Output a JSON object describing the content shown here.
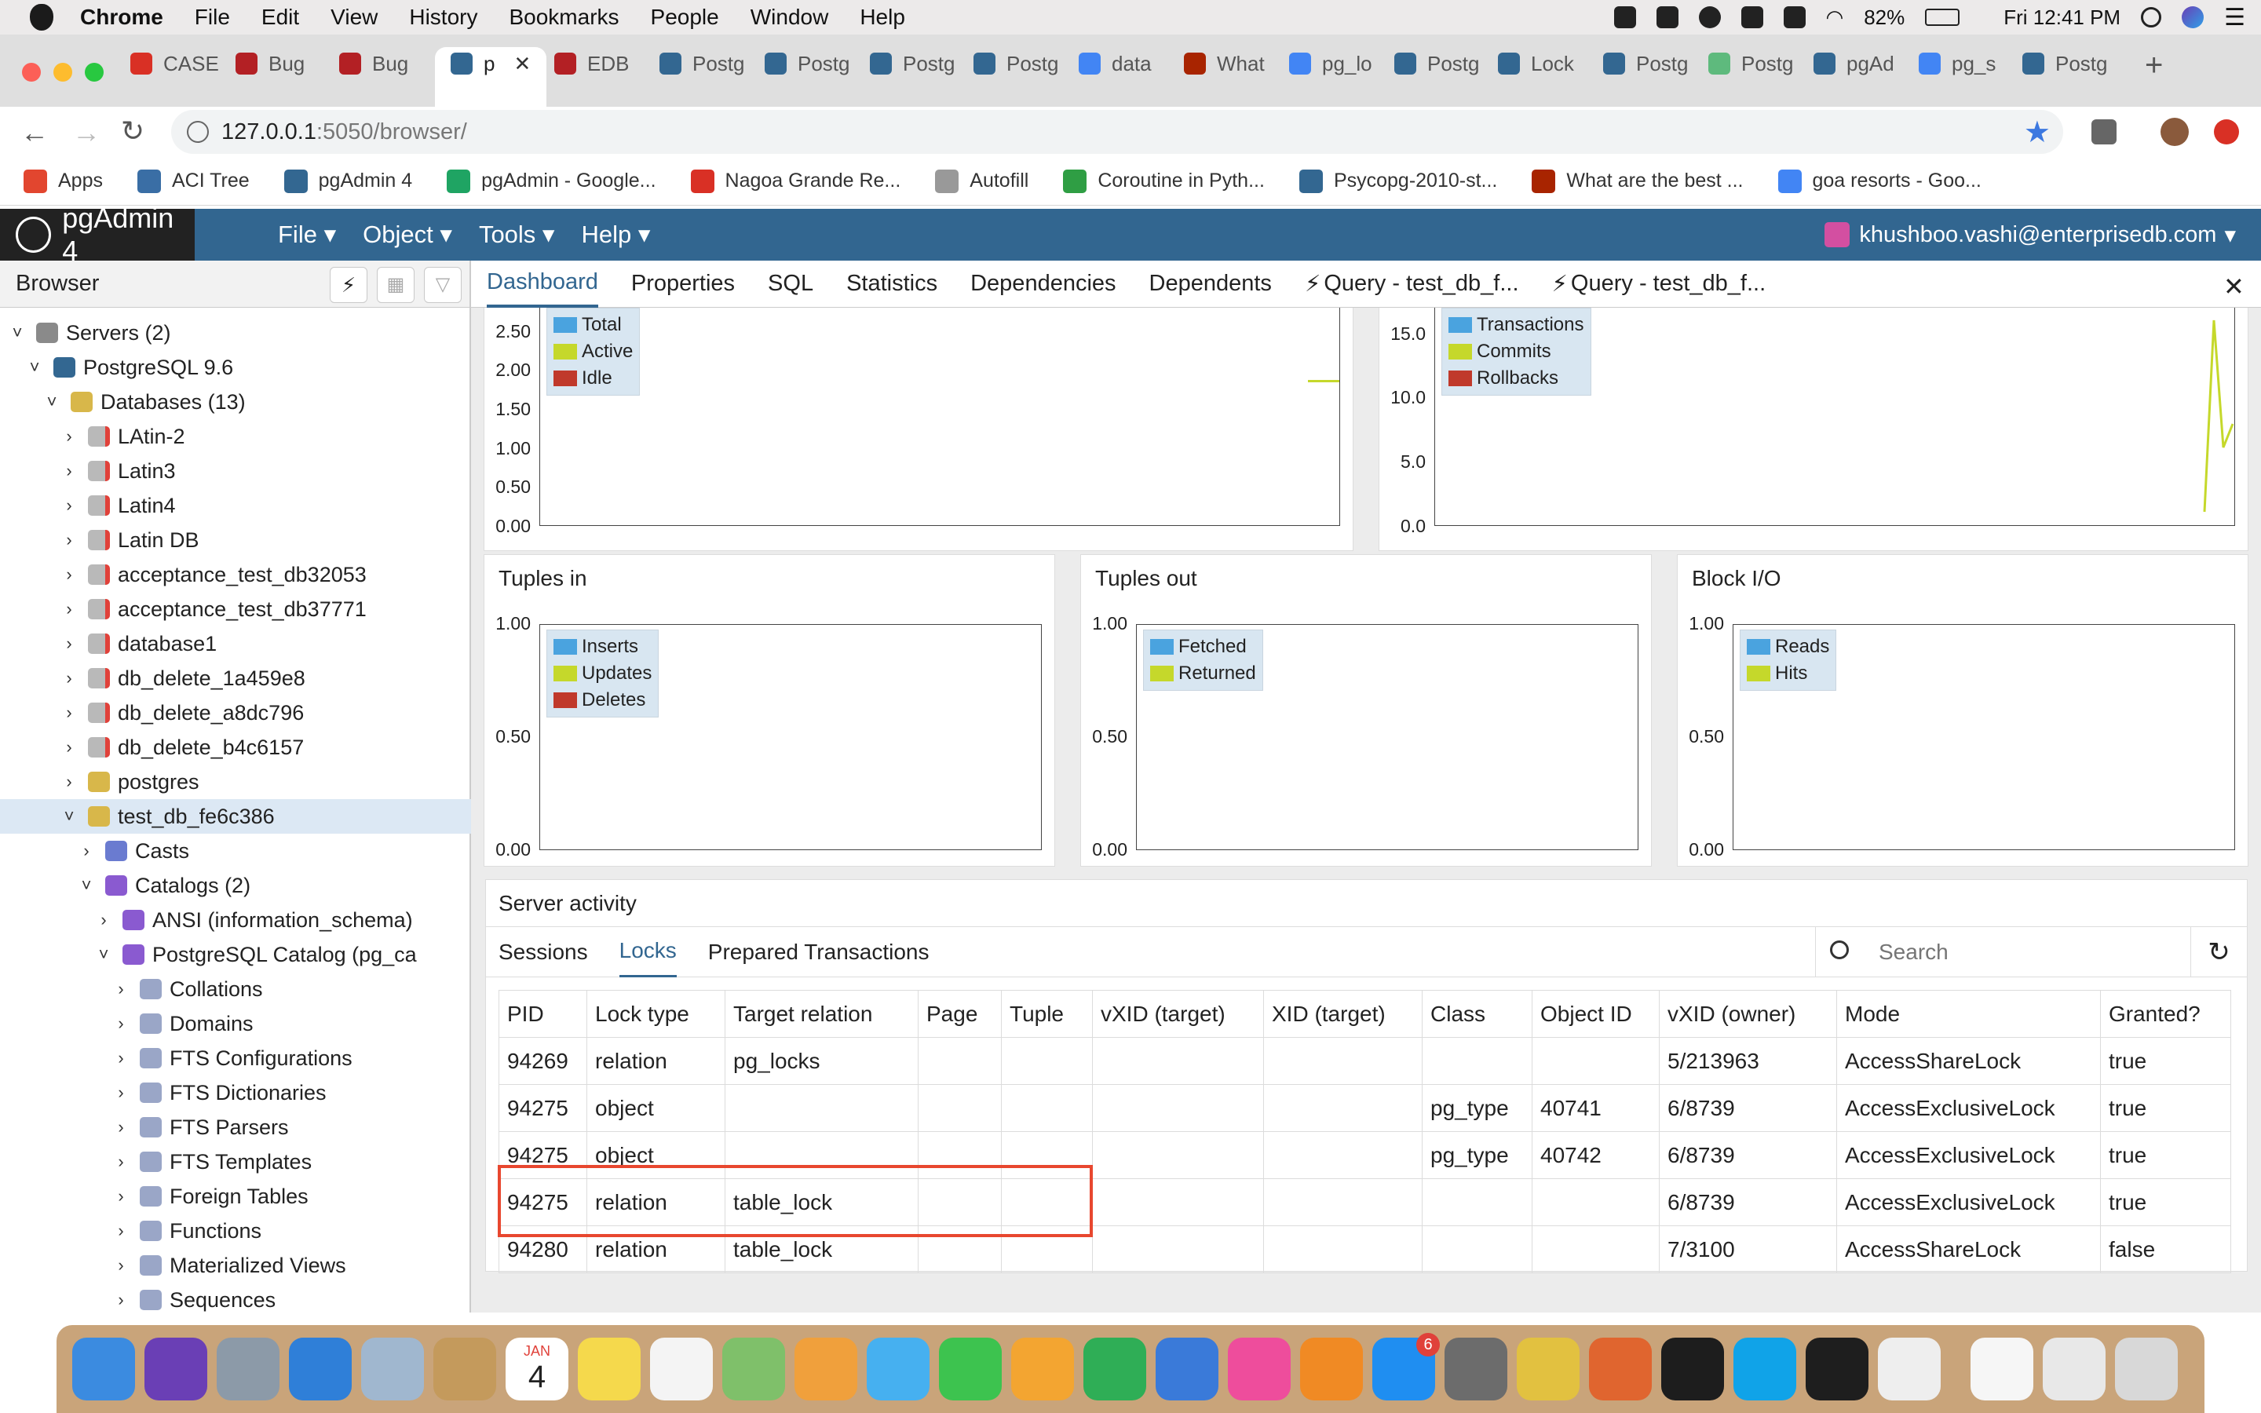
{
  "menubar": {
    "app_name": "Chrome",
    "items": [
      "File",
      "Edit",
      "View",
      "History",
      "Bookmarks",
      "People",
      "Window",
      "Help"
    ],
    "battery": "82%",
    "clock": "Fri 12:41 PM"
  },
  "tabs": [
    {
      "label": "CASE",
      "icon": "gmail-icon",
      "color": "#d93025"
    },
    {
      "label": "Bug",
      "icon": "redmine-icon",
      "color": "#b32024"
    },
    {
      "label": "Bug",
      "icon": "redmine-icon",
      "color": "#b32024"
    },
    {
      "label": "p",
      "icon": "elephant-icon",
      "color": "#336791"
    },
    {
      "label": "EDB",
      "icon": "redmine-icon",
      "color": "#b32024"
    },
    {
      "label": "Postg",
      "icon": "elephant-icon",
      "color": "#336791"
    },
    {
      "label": "Postg",
      "icon": "elephant-icon",
      "color": "#336791"
    },
    {
      "label": "Postg",
      "icon": "elephant-icon",
      "color": "#336791"
    },
    {
      "label": "Postg",
      "icon": "elephant-icon",
      "color": "#336791"
    },
    {
      "label": "data",
      "icon": "google-icon",
      "color": "#4285f4"
    },
    {
      "label": "What",
      "icon": "quora-icon",
      "color": "#a82400"
    },
    {
      "label": "pg_lo",
      "icon": "google-icon",
      "color": "#4285f4"
    },
    {
      "label": "Postg",
      "icon": "elephant-icon",
      "color": "#336791"
    },
    {
      "label": "Lock",
      "icon": "elephant-icon",
      "color": "#336791"
    },
    {
      "label": "Postg",
      "icon": "elephant-icon",
      "color": "#336791"
    },
    {
      "label": "Postg",
      "icon": "stackoverflow-icon",
      "color": "#5eba7d"
    },
    {
      "label": "pgAd",
      "icon": "elephant-icon",
      "color": "#336791"
    },
    {
      "label": "pg_s",
      "icon": "google-icon",
      "color": "#4285f4"
    },
    {
      "label": "Postg",
      "icon": "elephant-icon",
      "color": "#336791"
    }
  ],
  "address": {
    "host": "127.0.0.1",
    "rest": ":5050/browser/"
  },
  "bookmarks": [
    {
      "label": "Apps",
      "color": "#e2462f"
    },
    {
      "label": "ACI Tree",
      "color": "#3a6ea5"
    },
    {
      "label": "pgAdmin 4",
      "color": "#336791"
    },
    {
      "label": "pgAdmin - Google...",
      "color": "#1fa463"
    },
    {
      "label": "Nagoa Grande Re...",
      "color": "#d93025"
    },
    {
      "label": "Autofill",
      "color": "#999999"
    },
    {
      "label": "Coroutine in Pyth...",
      "color": "#2f9e44"
    },
    {
      "label": "Psycopg-2010-st...",
      "color": "#336791"
    },
    {
      "label": "What are the best ...",
      "color": "#a82400"
    },
    {
      "label": "goa resorts - Goo...",
      "color": "#4285f4"
    }
  ],
  "pgadmin": {
    "logo": "pgAdmin 4",
    "menus": [
      "File",
      "Object",
      "Tools",
      "Help"
    ],
    "user": "khushboo.vashi@enterprisedb.com"
  },
  "browser": {
    "title": "Browser",
    "tree": [
      {
        "label": "Servers (2)",
        "level": 0,
        "expanded": true,
        "icon": "servers-icon"
      },
      {
        "label": "PostgreSQL 9.6",
        "level": 1,
        "expanded": true,
        "icon": "elephant-icon"
      },
      {
        "label": "Databases (13)",
        "level": 2,
        "expanded": true,
        "icon": "database-icon"
      },
      {
        "label": "LAtin-2",
        "level": 3,
        "expanded": false,
        "icon": "database-disconnected-icon"
      },
      {
        "label": "Latin3",
        "level": 3,
        "expanded": false,
        "icon": "database-disconnected-icon"
      },
      {
        "label": "Latin4",
        "level": 3,
        "expanded": false,
        "icon": "database-disconnected-icon"
      },
      {
        "label": "Latin DB",
        "level": 3,
        "expanded": false,
        "icon": "database-disconnected-icon"
      },
      {
        "label": "acceptance_test_db32053",
        "level": 3,
        "expanded": false,
        "icon": "database-disconnected-icon"
      },
      {
        "label": "acceptance_test_db37771",
        "level": 3,
        "expanded": false,
        "icon": "database-disconnected-icon"
      },
      {
        "label": "database1",
        "level": 3,
        "expanded": false,
        "icon": "database-disconnected-icon"
      },
      {
        "label": "db_delete_1a459e8",
        "level": 3,
        "expanded": false,
        "icon": "database-disconnected-icon"
      },
      {
        "label": "db_delete_a8dc796",
        "level": 3,
        "expanded": false,
        "icon": "database-disconnected-icon"
      },
      {
        "label": "db_delete_b4c6157",
        "level": 3,
        "expanded": false,
        "icon": "database-disconnected-icon"
      },
      {
        "label": "postgres",
        "level": 3,
        "expanded": false,
        "icon": "database-icon"
      },
      {
        "label": "test_db_fe6c386",
        "level": 3,
        "expanded": true,
        "icon": "database-icon",
        "selected": true
      },
      {
        "label": "Casts",
        "level": 4,
        "expanded": false,
        "icon": "casts-icon"
      },
      {
        "label": "Catalogs (2)",
        "level": 4,
        "expanded": true,
        "icon": "catalogs-icon"
      },
      {
        "label": "ANSI (information_schema)",
        "level": 5,
        "expanded": false,
        "icon": "catalog-icon"
      },
      {
        "label": "PostgreSQL Catalog (pg_ca",
        "level": 5,
        "expanded": true,
        "icon": "catalog-icon"
      },
      {
        "label": "Collations",
        "level": 6,
        "expanded": false,
        "icon": "collation-icon"
      },
      {
        "label": "Domains",
        "level": 6,
        "expanded": false,
        "icon": "domain-icon"
      },
      {
        "label": "FTS Configurations",
        "level": 6,
        "expanded": false,
        "icon": "fts-config-icon"
      },
      {
        "label": "FTS Dictionaries",
        "level": 6,
        "expanded": false,
        "icon": "fts-dictionary-icon"
      },
      {
        "label": "FTS Parsers",
        "level": 6,
        "expanded": false,
        "icon": "fts-parser-icon"
      },
      {
        "label": "FTS Templates",
        "level": 6,
        "expanded": false,
        "icon": "fts-template-icon"
      },
      {
        "label": "Foreign Tables",
        "level": 6,
        "expanded": false,
        "icon": "foreign-table-icon"
      },
      {
        "label": "Functions",
        "level": 6,
        "expanded": false,
        "icon": "function-icon"
      },
      {
        "label": "Materialized Views",
        "level": 6,
        "expanded": false,
        "icon": "mview-icon"
      },
      {
        "label": "Sequences",
        "level": 6,
        "expanded": false,
        "icon": "sequence-icon"
      }
    ]
  },
  "panel_tabs": [
    "Dashboard",
    "Properties",
    "SQL",
    "Statistics",
    "Dependencies",
    "Dependents",
    "Query - test_db_f...",
    "Query - test_db_f..."
  ],
  "chart_data": [
    {
      "type": "line",
      "title": "",
      "series": [
        {
          "name": "Total",
          "color": "#4aa3df"
        },
        {
          "name": "Active",
          "color": "#c5d82b"
        },
        {
          "name": "Idle",
          "color": "#c0392b"
        }
      ],
      "yticks": [
        "2.50",
        "2.00",
        "1.50",
        "1.00",
        "0.50",
        "0.00"
      ],
      "ylim": [
        0,
        2.8
      ]
    },
    {
      "type": "line",
      "title": "",
      "series": [
        {
          "name": "Transactions",
          "color": "#4aa3df"
        },
        {
          "name": "Commits",
          "color": "#c5d82b"
        },
        {
          "name": "Rollbacks",
          "color": "#c0392b"
        }
      ],
      "yticks": [
        "15.0",
        "10.0",
        "5.0",
        "0.0"
      ],
      "ylim": [
        0,
        17
      ]
    },
    {
      "type": "line",
      "title": "Tuples in",
      "series": [
        {
          "name": "Inserts",
          "color": "#4aa3df"
        },
        {
          "name": "Updates",
          "color": "#c5d82b"
        },
        {
          "name": "Deletes",
          "color": "#c0392b"
        }
      ],
      "yticks": [
        "1.00",
        "0.50",
        "0.00"
      ],
      "ylim": [
        0,
        1
      ]
    },
    {
      "type": "line",
      "title": "Tuples out",
      "series": [
        {
          "name": "Fetched",
          "color": "#4aa3df"
        },
        {
          "name": "Returned",
          "color": "#c5d82b"
        }
      ],
      "yticks": [
        "1.00",
        "0.50",
        "0.00"
      ],
      "ylim": [
        0,
        1
      ]
    },
    {
      "type": "line",
      "title": "Block I/O",
      "series": [
        {
          "name": "Reads",
          "color": "#4aa3df"
        },
        {
          "name": "Hits",
          "color": "#c5d82b"
        }
      ],
      "yticks": [
        "1.00",
        "0.50",
        "0.00"
      ],
      "ylim": [
        0,
        1
      ]
    }
  ],
  "activity": {
    "title": "Server activity",
    "subtabs": [
      "Sessions",
      "Locks",
      "Prepared Transactions"
    ],
    "search_placeholder": "Search",
    "columns": [
      "PID",
      "Lock type",
      "Target relation",
      "Page",
      "Tuple",
      "vXID (target)",
      "XID (target)",
      "Class",
      "Object ID",
      "vXID (owner)",
      "Mode",
      "Granted?"
    ],
    "rows": [
      [
        "94269",
        "relation",
        "pg_locks",
        "",
        "",
        "",
        "",
        "",
        "",
        "5/213963",
        "AccessShareLock",
        "true"
      ],
      [
        "94275",
        "object",
        "",
        "",
        "",
        "",
        "",
        "pg_type",
        "40741",
        "6/8739",
        "AccessExclusiveLock",
        "true"
      ],
      [
        "94275",
        "object",
        "",
        "",
        "",
        "",
        "",
        "pg_type",
        "40742",
        "6/8739",
        "AccessExclusiveLock",
        "true"
      ],
      [
        "94275",
        "relation",
        "table_lock",
        "",
        "",
        "",
        "",
        "",
        "",
        "6/8739",
        "AccessExclusiveLock",
        "true"
      ],
      [
        "94280",
        "relation",
        "table_lock",
        "",
        "",
        "",
        "",
        "",
        "",
        "7/3100",
        "AccessShareLock",
        "false"
      ]
    ]
  },
  "dock": {
    "calendar_month": "JAN",
    "calendar_day": "4",
    "appstore_badge": "6",
    "apps": [
      {
        "name": "finder",
        "color": "#3b8be0"
      },
      {
        "name": "siri",
        "color": "#6a3fb5"
      },
      {
        "name": "launchpad",
        "color": "#8c9aa8"
      },
      {
        "name": "safari",
        "color": "#2f7fd8"
      },
      {
        "name": "mail",
        "color": "#a0b7cf"
      },
      {
        "name": "contacts",
        "color": "#c49a5c"
      },
      {
        "name": "calendar",
        "color": "#ffffff"
      },
      {
        "name": "notes",
        "color": "#f5d94c"
      },
      {
        "name": "reminders",
        "color": "#f4f4f4"
      },
      {
        "name": "maps",
        "color": "#7fc06a"
      },
      {
        "name": "photos",
        "color": "#f0a03c"
      },
      {
        "name": "messages",
        "color": "#46b0f0"
      },
      {
        "name": "facetime",
        "color": "#3dc34f"
      },
      {
        "name": "pages",
        "color": "#f3a531"
      },
      {
        "name": "numbers",
        "color": "#2fae56"
      },
      {
        "name": "keynote",
        "color": "#3a7ad9"
      },
      {
        "name": "itunes",
        "color": "#ee4d9c"
      },
      {
        "name": "books",
        "color": "#f08a24"
      },
      {
        "name": "appstore",
        "color": "#1f8ef1"
      },
      {
        "name": "system-preferences",
        "color": "#6c6c6c"
      },
      {
        "name": "chrome",
        "color": "#e2c140"
      },
      {
        "name": "vmware",
        "color": "#e0652f"
      },
      {
        "name": "terminal",
        "color": "#1d1d1d"
      },
      {
        "name": "skype",
        "color": "#10a3e8"
      },
      {
        "name": "pycharm",
        "color": "#1e1e1e"
      },
      {
        "name": "textedit",
        "color": "#eeeeee"
      },
      {
        "name": "document",
        "color": "#f6f6f6"
      },
      {
        "name": "spreadsheet",
        "color": "#e8e8e8"
      },
      {
        "name": "trash",
        "color": "#d8d8d8"
      }
    ]
  }
}
